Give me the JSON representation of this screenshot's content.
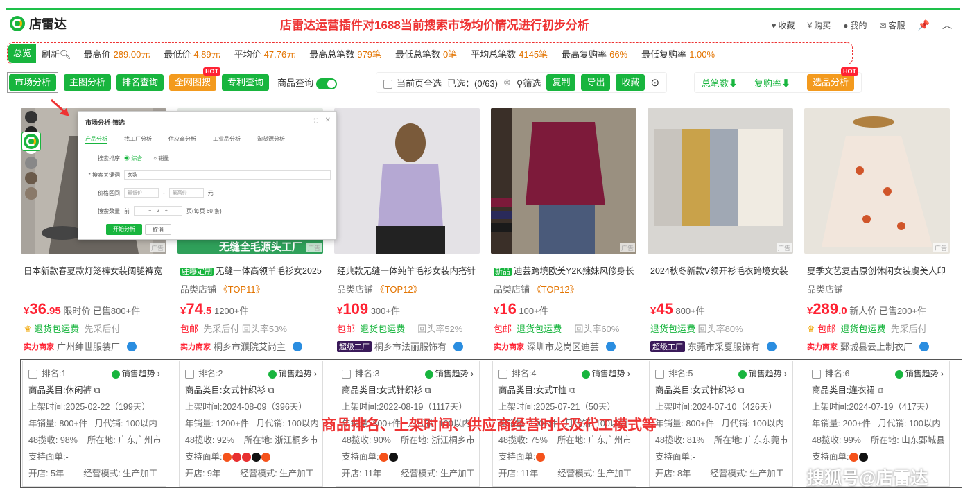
{
  "header": {
    "logo_text": "店雷达",
    "headline": "店雷达运营插件对1688当前搜索市场均价情况进行初步分析",
    "nav": [
      {
        "icon": "heart-icon",
        "label": "收藏"
      },
      {
        "icon": "yen-icon",
        "label": "购买"
      },
      {
        "icon": "user-icon",
        "label": "我的"
      },
      {
        "icon": "chat-icon",
        "label": "客服"
      }
    ]
  },
  "stats": {
    "tab": "总览",
    "refresh": "刷新",
    "items": [
      {
        "label": "最高价",
        "value": "289.00元"
      },
      {
        "label": "最低价",
        "value": "4.89元"
      },
      {
        "label": "平均价",
        "value": "47.76元"
      },
      {
        "label": "最高总笔数",
        "value": "979笔"
      },
      {
        "label": "最低总笔数",
        "value": "0笔"
      },
      {
        "label": "平均总笔数",
        "value": "4145笔"
      },
      {
        "label": "最高复购率",
        "value": "66%"
      },
      {
        "label": "最低复购率",
        "value": "1.00%"
      }
    ]
  },
  "toolbar": {
    "market": "市场分析",
    "main_img": "主图分析",
    "rank": "排名查询",
    "image_search": "全网图搜",
    "hot": "HOT",
    "patent": "专利查询",
    "goods_query": "商品查询",
    "select_all": "当前页全选",
    "selected": "已选：(0/63)",
    "filter": "筛选",
    "copy": "复制",
    "export": "导出",
    "collect": "收藏",
    "sort_total": "总笔数⬇",
    "sort_repurchase": "复购率⬇",
    "select_analysis": "选品分析"
  },
  "dialog": {
    "title": "市场分析-筛选",
    "tabs": [
      "产品分析",
      "找工厂分析",
      "供应商分析",
      "工业品分析",
      "淘货源分析"
    ],
    "sort_label": "搜索排序",
    "sort_options": [
      "综合",
      "销量"
    ],
    "keyword_label": "* 搜索关键词",
    "keyword_value": "女装",
    "price_label": "价格区间",
    "price_min": "最低价",
    "price_max": "最高价",
    "price_unit": "元",
    "count_label": "搜索数量",
    "count_prefix": "前",
    "count_value": "2",
    "count_suffix": "页(每页 60 条)",
    "start_btn": "开始分析",
    "cancel_btn": "取消"
  },
  "ad_label": "广告",
  "products": [
    {
      "tag": "",
      "title": "日本新款春夏款灯笼裤女装阔腿裤宽",
      "shop": "品类店铺",
      "top": "",
      "price_int": "36",
      "price_dec": ".95",
      "price_note": "限时价 已售800+件",
      "serv1": "退货包运费",
      "serv2": "先采后付",
      "serv_pre": "",
      "merchant_tag": "实力商家",
      "merchant": "广州绅世服装厂",
      "img_bg": "#a8a39c",
      "img_fg": "#6a655f"
    },
    {
      "tag": "驻曝定制",
      "title": "无缝一体高领羊毛衫女2025",
      "shop": "品类店铺",
      "top": "TOP11",
      "price_int": "74",
      "price_dec": ".5",
      "price_note": "1200+件",
      "serv1": "包邮",
      "serv2": "先采后付 回头率53%",
      "serv_pre": "",
      "merchant_tag": "实力商家",
      "merchant": "桐乡市濮院艾尚主",
      "img_bg": "#eef3ee",
      "img_fg": "#2fa05a",
      "banner": "无缝全毛源头工厂"
    },
    {
      "tag": "",
      "title": "经典款无缝一体纯羊毛衫女装内搭针",
      "shop": "品类店铺",
      "top": "TOP12",
      "price_int": "109",
      "price_dec": "",
      "price_note": "300+件",
      "serv1": "包邮",
      "serv2": "退货包运费",
      "serv3": "回头率52%",
      "merchant_tag": "超级工厂",
      "merchant": "桐乡市法丽服饰有",
      "img_bg": "#d9d4e4",
      "img_fg": "#b5a8d3"
    },
    {
      "tag": "新品",
      "title": "迪芸跨境欧美Y2K辣妹风修身长",
      "shop": "品类店铺",
      "top": "TOP12",
      "price_int": "16",
      "price_dec": "",
      "price_note": "100+件",
      "serv1": "包邮",
      "serv2": "退货包运费",
      "serv3": "回头率60%",
      "merchant_tag": "实力商家",
      "merchant": "深圳市龙岗区迪芸",
      "img_bg": "#8c8276",
      "img_fg": "#7d1a3a"
    },
    {
      "tag": "",
      "title": "2024秋冬新款V领开衫毛衣跨境女装",
      "shop": "",
      "top": "",
      "price_int": "45",
      "price_dec": "",
      "price_note": "800+件",
      "serv1": "退货包运费",
      "serv2": "回头率80%",
      "merchant_tag": "超级工厂",
      "merchant": "东莞市采夏服饰有",
      "img_bg": "#d8d6d2",
      "img_fg": "#c9a24a"
    },
    {
      "tag": "",
      "title": "夏季文艺复古原创休闲女装虞美人印",
      "shop": "品类店铺",
      "top": "",
      "price_int": "289",
      "price_dec": ".0",
      "price_note": "新人价 已售200+件",
      "serv1": "包邮",
      "serv2": "退货包运费",
      "serv3": "先采后付",
      "merchant_tag": "实力商家",
      "merchant": "鄄城县云上制衣厂",
      "img_bg": "#e8e4dc",
      "img_fg": "#d0552a"
    }
  ],
  "info": [
    {
      "rank": "排名:1",
      "trend": "销售趋势",
      "category": "商品类目:休闲裤",
      "listed": "上架时间:2025-02-22（199天）",
      "sales": "年销量: 800+件",
      "agent": "月代销: 100以内",
      "rate": "48揽收: 98%",
      "loc": "所在地: 广东广州市",
      "support": "支持面单:-",
      "open": "开店: 5年",
      "mode": "经营模式: 生产加工"
    },
    {
      "rank": "排名:2",
      "trend": "销售趋势",
      "category": "商品类目:女式针织衫",
      "listed": "上架时间:2024-08-09（396天）",
      "sales": "年销量: 1200+件",
      "agent": "月代销: 100以内",
      "rate": "48揽收: 92%",
      "loc": "所在地: 浙江桐乡市",
      "support": "支持面单:",
      "open": "开店: 9年",
      "mode": "经营模式: 生产加工"
    },
    {
      "rank": "排名:3",
      "trend": "销售趋势",
      "category": "商品类目:女式针织衫",
      "listed": "上架时间:2022-08-19（1117天）",
      "sales": "年销量: 300+件",
      "agent": "月代销: 100以内",
      "rate": "48揽收: 90%",
      "loc": "所在地: 浙江桐乡市",
      "support": "支持面单:",
      "open": "开店: 11年",
      "mode": "经营模式: 生产加工"
    },
    {
      "rank": "排名:4",
      "trend": "销售趋势",
      "category": "商品类目:女式T恤",
      "listed": "上架时间:2025-07-21（50天）",
      "sales": "年销量: 100+件",
      "agent": "月代销: 100以内",
      "rate": "48揽收: 75%",
      "loc": "所在地: 广东广州市",
      "support": "支持面单:",
      "open": "开店: 11年",
      "mode": "经营模式: 生产加工"
    },
    {
      "rank": "排名:5",
      "trend": "销售趋势",
      "category": "商品类目:女式针织衫",
      "listed": "上架时间:2024-07-10（426天）",
      "sales": "年销量: 800+件",
      "agent": "月代销: 100以内",
      "rate": "48揽收: 81%",
      "loc": "所在地: 广东东莞市",
      "support": "支持面单:-",
      "open": "开店: 8年",
      "mode": "经营模式: 生产加工"
    },
    {
      "rank": "排名:6",
      "trend": "销售趋势",
      "category": "商品类目:连衣裙",
      "listed": "上架时间:2024-07-19（417天）",
      "sales": "年销量: 200+件",
      "agent": "月代销: 100以内",
      "rate": "48揽收: 99%",
      "loc": "所在地: 山东鄄城县",
      "support": "支持面单:",
      "open": "",
      "mode": ""
    }
  ],
  "overlay_text": "商品排名、上架时间、供应商经营时长及代工模式等",
  "watermark": "搜狐号@店雷达",
  "colors": {
    "accent": "#18b53e",
    "price": "#ff2233",
    "warn": "#e37400"
  }
}
